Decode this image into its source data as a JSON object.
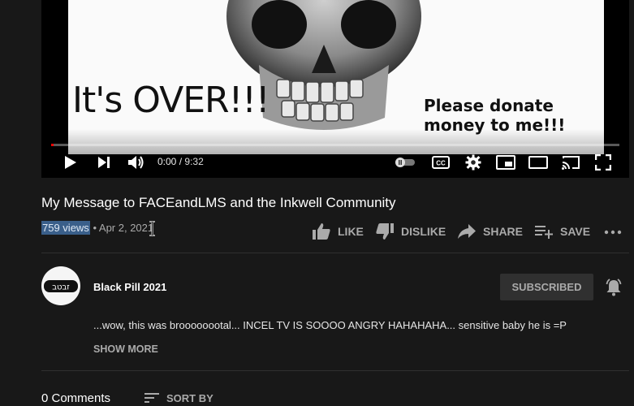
{
  "video": {
    "frame_text_left": "It's OVER!!!",
    "frame_text_right_line1": "Please donate",
    "frame_text_right_line2": "money to me!!!",
    "progress_fraction": 0.0,
    "time_current": "0:00",
    "time_separator": "/",
    "time_total": "9:32",
    "controls": [
      "play-icon",
      "next-icon",
      "volume-icon",
      "autoplay-toggle",
      "captions-icon",
      "settings-icon",
      "miniplayer-icon",
      "theater-icon",
      "cast-icon",
      "fullscreen-icon"
    ],
    "captions_label": "CC"
  },
  "info": {
    "title": "My Message to FACEandLMS and the Inkwell Community",
    "views": "759 views",
    "dot": "•",
    "date": "Apr 2, 2021"
  },
  "actions": {
    "like": "LIKE",
    "dislike": "DISLIKE",
    "share": "SHARE",
    "save": "SAVE"
  },
  "channel": {
    "avatar_text": "זבטב",
    "name": "Black Pill 2021",
    "subscribed_label": "SUBSCRIBED"
  },
  "description": {
    "text": "...wow, this was broooooootal... INCEL TV IS SOOOO ANGRY HAHAHAHA... sensitive baby he is =P",
    "show_more": "SHOW MORE"
  },
  "comments": {
    "count_label": "0 Comments",
    "sort_label": "SORT BY"
  },
  "colors": {
    "background": "#181818",
    "progress": "#ff0000",
    "selection": "#3a5f8a",
    "muted_text": "#aaaaaa",
    "button_bg": "#303030"
  }
}
